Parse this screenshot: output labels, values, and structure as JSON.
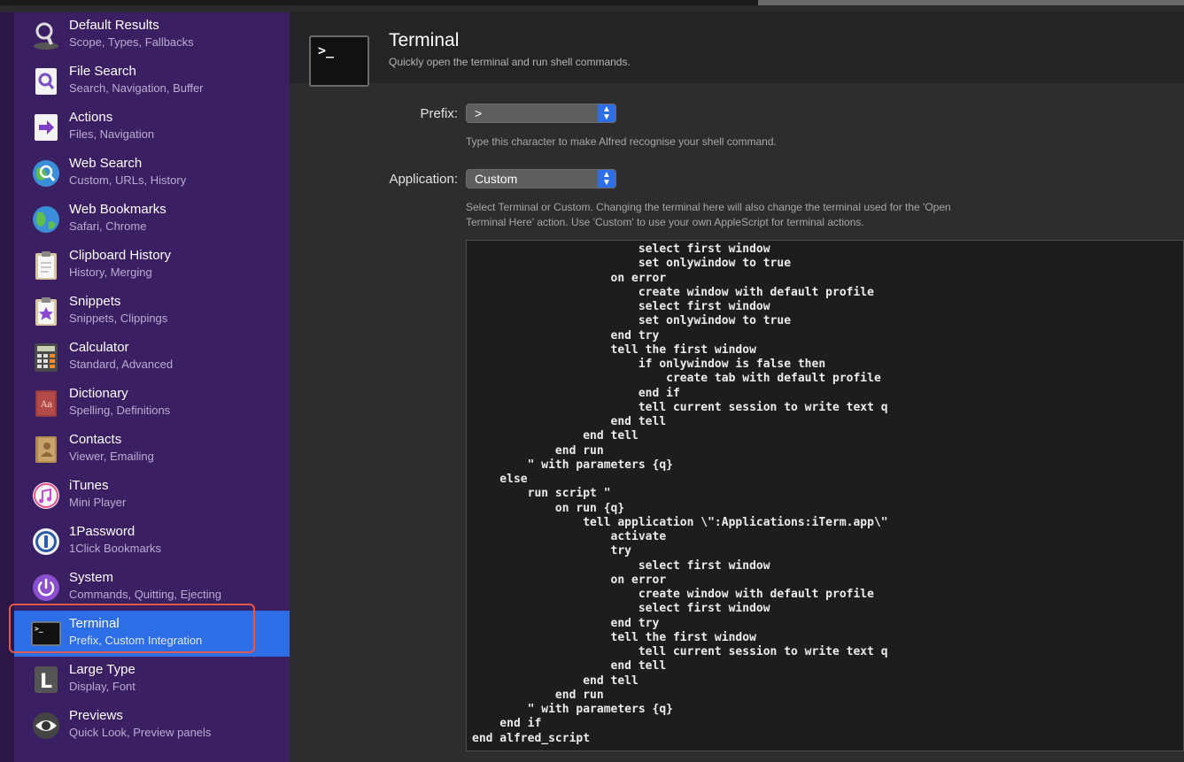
{
  "sidebar": {
    "items": [
      {
        "title": "Default Results",
        "subtitle": "Scope, Types, Fallbacks",
        "icon": "magnifier-icon"
      },
      {
        "title": "File Search",
        "subtitle": "Search, Navigation, Buffer",
        "icon": "file-search-icon"
      },
      {
        "title": "Actions",
        "subtitle": "Files, Navigation",
        "icon": "arrow-icon"
      },
      {
        "title": "Web Search",
        "subtitle": "Custom, URLs, History",
        "icon": "globe-search-icon"
      },
      {
        "title": "Web Bookmarks",
        "subtitle": "Safari, Chrome",
        "icon": "globe-icon"
      },
      {
        "title": "Clipboard History",
        "subtitle": "History, Merging",
        "icon": "clipboard-icon"
      },
      {
        "title": "Snippets",
        "subtitle": "Snippets, Clippings",
        "icon": "snippets-icon"
      },
      {
        "title": "Calculator",
        "subtitle": "Standard, Advanced",
        "icon": "calculator-icon"
      },
      {
        "title": "Dictionary",
        "subtitle": "Spelling, Definitions",
        "icon": "dictionary-icon"
      },
      {
        "title": "Contacts",
        "subtitle": "Viewer, Emailing",
        "icon": "contacts-icon"
      },
      {
        "title": "iTunes",
        "subtitle": "Mini Player",
        "icon": "itunes-icon"
      },
      {
        "title": "1Password",
        "subtitle": "1Click Bookmarks",
        "icon": "1password-icon"
      },
      {
        "title": "System",
        "subtitle": "Commands, Quitting, Ejecting",
        "icon": "power-icon"
      },
      {
        "title": "Terminal",
        "subtitle": "Prefix, Custom Integration",
        "icon": "terminal-icon",
        "selected": true
      },
      {
        "title": "Large Type",
        "subtitle": "Display, Font",
        "icon": "large-type-icon"
      },
      {
        "title": "Previews",
        "subtitle": "Quick Look, Preview panels",
        "icon": "eye-icon"
      }
    ]
  },
  "header": {
    "icon_glyph": ">_",
    "title": "Terminal",
    "subtitle": "Quickly open the terminal and run shell commands."
  },
  "form": {
    "prefix_label": "Prefix:",
    "prefix_value": ">",
    "prefix_hint": "Type this character to make Alfred recognise your shell command.",
    "application_label": "Application:",
    "application_value": "Custom",
    "application_hint_line1": "Select Terminal or Custom. Changing the terminal here will also change the terminal used for the 'Open",
    "application_hint_line2": "Terminal Here' action. Use 'Custom' to use your own AppleScript for terminal actions."
  },
  "script": {
    "lines": [
      "                        select first window",
      "                        set onlywindow to true",
      "                    on error",
      "                        create window with default profile",
      "                        select first window",
      "                        set onlywindow to true",
      "                    end try",
      "                    tell the first window",
      "                        if onlywindow is false then",
      "                            create tab with default profile",
      "                        end if",
      "                        tell current session to write text q",
      "                    end tell",
      "                end tell",
      "            end run",
      "        \" with parameters {q}",
      "    else",
      "        run script \"",
      "            on run {q}",
      "                tell application \\\":Applications:iTerm.app\\\"",
      "                    activate",
      "                    try",
      "                        select first window",
      "                    on error",
      "                        create window with default profile",
      "                        select first window",
      "                    end try",
      "                    tell the first window",
      "                        tell current session to write text q",
      "                    end tell",
      "                end tell",
      "            end run",
      "        \" with parameters {q}",
      "    end if",
      "end alfred_script"
    ]
  },
  "colors": {
    "sidebar_bg": "#3a1f63",
    "selected_bg": "#2d6ee6",
    "highlight_outline": "#e0584a",
    "code_bg": "#1d1d1f"
  }
}
